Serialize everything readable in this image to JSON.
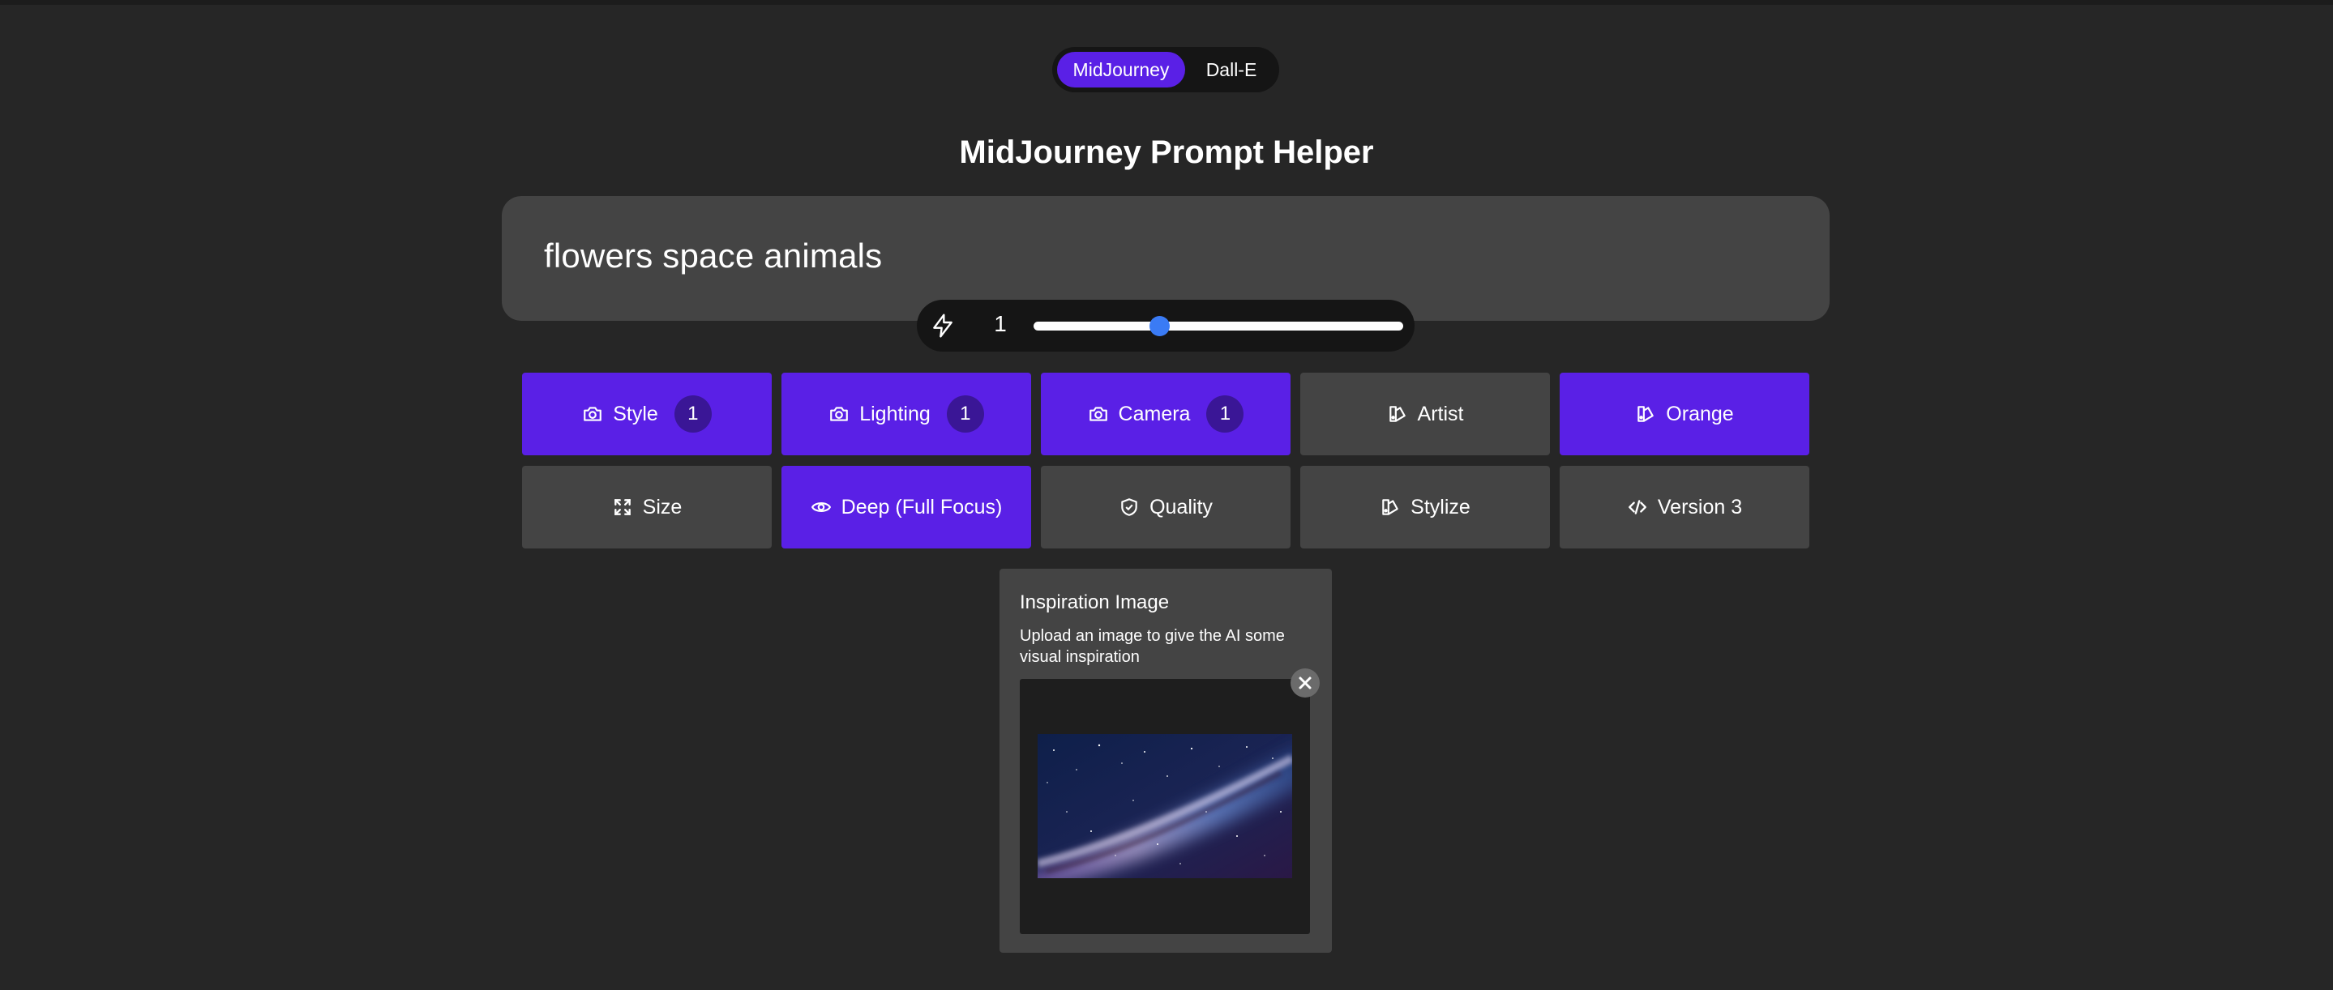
{
  "engine_toggle": {
    "options": [
      "MidJourney",
      "Dall-E"
    ],
    "selected": "MidJourney"
  },
  "page_title": "MidJourney Prompt Helper",
  "prompt": {
    "value": "flowers space animals"
  },
  "slider": {
    "value": "1",
    "fill_fraction": 0.34,
    "icon": "lightning-bolt-icon"
  },
  "options": {
    "style": {
      "label": "Style",
      "badge": "1",
      "icon": "camera-icon"
    },
    "lighting": {
      "label": "Lighting",
      "badge": "1",
      "icon": "camera-icon"
    },
    "camera": {
      "label": "Camera",
      "badge": "1",
      "icon": "camera-icon"
    },
    "artist": {
      "label": "Artist",
      "icon": "palette-icon"
    },
    "orange": {
      "label": "Orange",
      "icon": "palette-icon"
    },
    "size": {
      "label": "Size",
      "icon": "expand-icon"
    },
    "depth": {
      "label": "Deep (Full Focus)",
      "icon": "eye-icon"
    },
    "quality": {
      "label": "Quality",
      "icon": "shield-check-icon"
    },
    "stylize": {
      "label": "Stylize",
      "icon": "palette-icon"
    },
    "version": {
      "label": "Version 3",
      "icon": "code-icon"
    }
  },
  "inspiration": {
    "title": "Inspiration Image",
    "description": "Upload an image to give the AI some visual inspiration",
    "image": "milky-way-galaxy-image",
    "close_icon": "close-icon"
  },
  "colors": {
    "background": "#262626",
    "panel": "#444444",
    "accent": "#5a20e6",
    "badge": "#3a1696",
    "slider_thumb": "#3a7bf5"
  }
}
